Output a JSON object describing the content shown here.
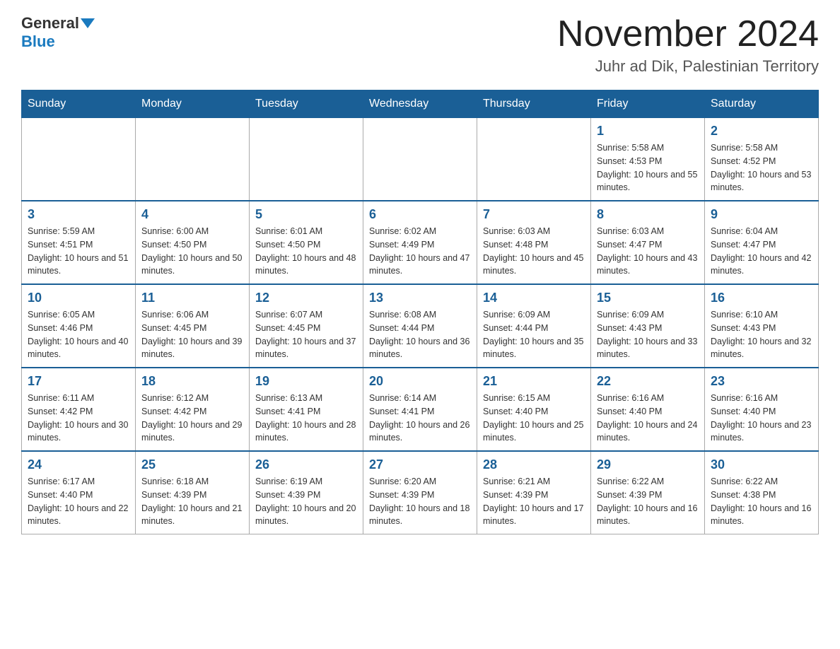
{
  "logo": {
    "general": "General",
    "blue": "Blue"
  },
  "title": "November 2024",
  "location": "Juhr ad Dik, Palestinian Territory",
  "days_of_week": [
    "Sunday",
    "Monday",
    "Tuesday",
    "Wednesday",
    "Thursday",
    "Friday",
    "Saturday"
  ],
  "weeks": [
    [
      {
        "day": "",
        "info": ""
      },
      {
        "day": "",
        "info": ""
      },
      {
        "day": "",
        "info": ""
      },
      {
        "day": "",
        "info": ""
      },
      {
        "day": "",
        "info": ""
      },
      {
        "day": "1",
        "info": "Sunrise: 5:58 AM\nSunset: 4:53 PM\nDaylight: 10 hours and 55 minutes."
      },
      {
        "day": "2",
        "info": "Sunrise: 5:58 AM\nSunset: 4:52 PM\nDaylight: 10 hours and 53 minutes."
      }
    ],
    [
      {
        "day": "3",
        "info": "Sunrise: 5:59 AM\nSunset: 4:51 PM\nDaylight: 10 hours and 51 minutes."
      },
      {
        "day": "4",
        "info": "Sunrise: 6:00 AM\nSunset: 4:50 PM\nDaylight: 10 hours and 50 minutes."
      },
      {
        "day": "5",
        "info": "Sunrise: 6:01 AM\nSunset: 4:50 PM\nDaylight: 10 hours and 48 minutes."
      },
      {
        "day": "6",
        "info": "Sunrise: 6:02 AM\nSunset: 4:49 PM\nDaylight: 10 hours and 47 minutes."
      },
      {
        "day": "7",
        "info": "Sunrise: 6:03 AM\nSunset: 4:48 PM\nDaylight: 10 hours and 45 minutes."
      },
      {
        "day": "8",
        "info": "Sunrise: 6:03 AM\nSunset: 4:47 PM\nDaylight: 10 hours and 43 minutes."
      },
      {
        "day": "9",
        "info": "Sunrise: 6:04 AM\nSunset: 4:47 PM\nDaylight: 10 hours and 42 minutes."
      }
    ],
    [
      {
        "day": "10",
        "info": "Sunrise: 6:05 AM\nSunset: 4:46 PM\nDaylight: 10 hours and 40 minutes."
      },
      {
        "day": "11",
        "info": "Sunrise: 6:06 AM\nSunset: 4:45 PM\nDaylight: 10 hours and 39 minutes."
      },
      {
        "day": "12",
        "info": "Sunrise: 6:07 AM\nSunset: 4:45 PM\nDaylight: 10 hours and 37 minutes."
      },
      {
        "day": "13",
        "info": "Sunrise: 6:08 AM\nSunset: 4:44 PM\nDaylight: 10 hours and 36 minutes."
      },
      {
        "day": "14",
        "info": "Sunrise: 6:09 AM\nSunset: 4:44 PM\nDaylight: 10 hours and 35 minutes."
      },
      {
        "day": "15",
        "info": "Sunrise: 6:09 AM\nSunset: 4:43 PM\nDaylight: 10 hours and 33 minutes."
      },
      {
        "day": "16",
        "info": "Sunrise: 6:10 AM\nSunset: 4:43 PM\nDaylight: 10 hours and 32 minutes."
      }
    ],
    [
      {
        "day": "17",
        "info": "Sunrise: 6:11 AM\nSunset: 4:42 PM\nDaylight: 10 hours and 30 minutes."
      },
      {
        "day": "18",
        "info": "Sunrise: 6:12 AM\nSunset: 4:42 PM\nDaylight: 10 hours and 29 minutes."
      },
      {
        "day": "19",
        "info": "Sunrise: 6:13 AM\nSunset: 4:41 PM\nDaylight: 10 hours and 28 minutes."
      },
      {
        "day": "20",
        "info": "Sunrise: 6:14 AM\nSunset: 4:41 PM\nDaylight: 10 hours and 26 minutes."
      },
      {
        "day": "21",
        "info": "Sunrise: 6:15 AM\nSunset: 4:40 PM\nDaylight: 10 hours and 25 minutes."
      },
      {
        "day": "22",
        "info": "Sunrise: 6:16 AM\nSunset: 4:40 PM\nDaylight: 10 hours and 24 minutes."
      },
      {
        "day": "23",
        "info": "Sunrise: 6:16 AM\nSunset: 4:40 PM\nDaylight: 10 hours and 23 minutes."
      }
    ],
    [
      {
        "day": "24",
        "info": "Sunrise: 6:17 AM\nSunset: 4:40 PM\nDaylight: 10 hours and 22 minutes."
      },
      {
        "day": "25",
        "info": "Sunrise: 6:18 AM\nSunset: 4:39 PM\nDaylight: 10 hours and 21 minutes."
      },
      {
        "day": "26",
        "info": "Sunrise: 6:19 AM\nSunset: 4:39 PM\nDaylight: 10 hours and 20 minutes."
      },
      {
        "day": "27",
        "info": "Sunrise: 6:20 AM\nSunset: 4:39 PM\nDaylight: 10 hours and 18 minutes."
      },
      {
        "day": "28",
        "info": "Sunrise: 6:21 AM\nSunset: 4:39 PM\nDaylight: 10 hours and 17 minutes."
      },
      {
        "day": "29",
        "info": "Sunrise: 6:22 AM\nSunset: 4:39 PM\nDaylight: 10 hours and 16 minutes."
      },
      {
        "day": "30",
        "info": "Sunrise: 6:22 AM\nSunset: 4:38 PM\nDaylight: 10 hours and 16 minutes."
      }
    ]
  ]
}
